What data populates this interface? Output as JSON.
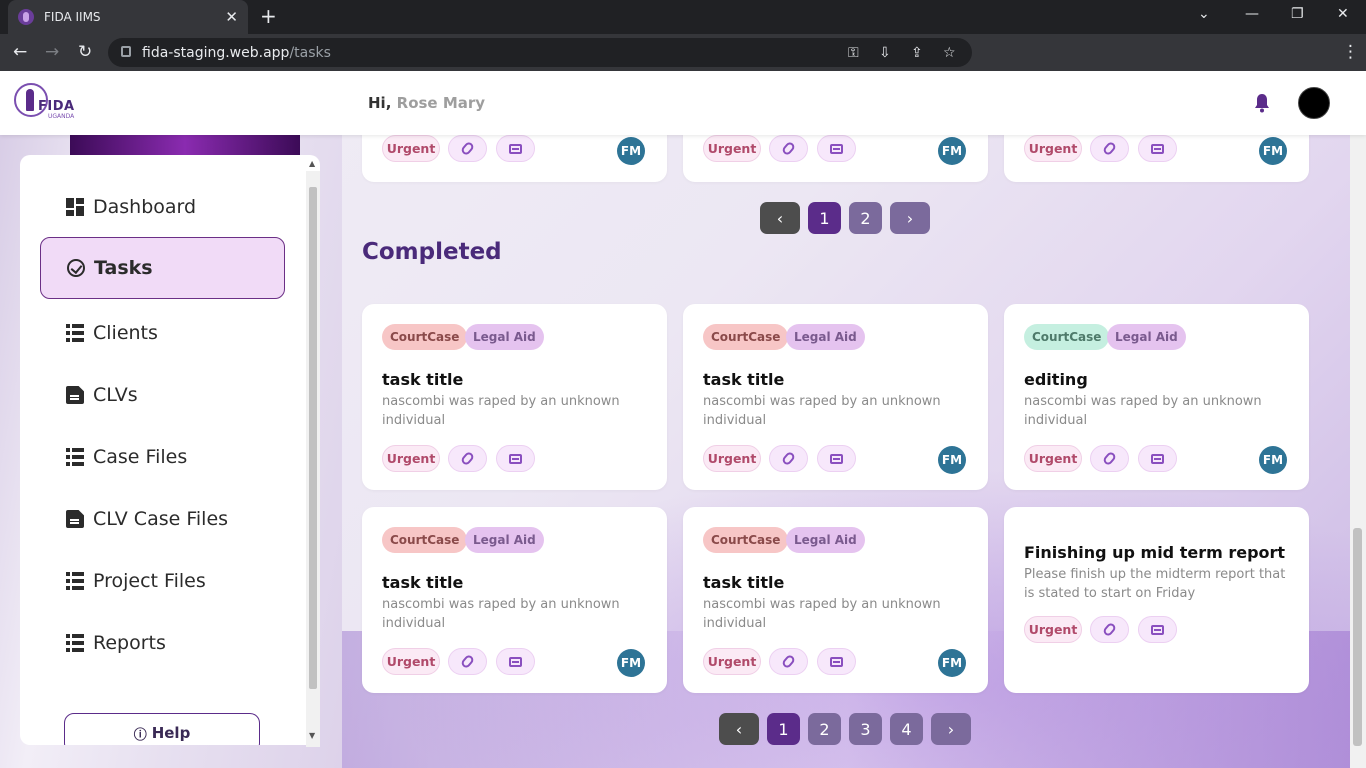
{
  "browser": {
    "tab_title": "FIDA IIMS",
    "url_domain": "fida-staging.web.app",
    "url_path": "/tasks"
  },
  "header": {
    "greeting": "Hi,",
    "user_name": "Rose Mary"
  },
  "logo": {
    "text": "FIDA",
    "sub": "UGANDA"
  },
  "sidebar": {
    "items": [
      {
        "label": "Dashboard",
        "icon": "dashboard-icon"
      },
      {
        "label": "Tasks",
        "icon": "check-circle-icon",
        "active": true
      },
      {
        "label": "Clients",
        "icon": "list-icon"
      },
      {
        "label": "CLVs",
        "icon": "document-icon"
      },
      {
        "label": "Case Files",
        "icon": "list-icon"
      },
      {
        "label": "CLV Case Files",
        "icon": "document-icon"
      },
      {
        "label": "Project Files",
        "icon": "list-icon"
      },
      {
        "label": "Reports",
        "icon": "list-icon"
      }
    ],
    "help_label": "Help"
  },
  "top_cards": [
    {
      "urgent": "Urgent",
      "assignee": "FM"
    },
    {
      "urgent": "Urgent",
      "assignee": "FM"
    },
    {
      "urgent": "Urgent",
      "assignee": "FM"
    }
  ],
  "top_pagination": {
    "pages": [
      "1",
      "2"
    ],
    "current": "1"
  },
  "completed": {
    "title": "Completed",
    "cards": [
      {
        "tags": [
          "CourtCase",
          "Legal Aid"
        ],
        "title": "task title",
        "description": "nascombi was raped by an unknown individual",
        "urgent": "Urgent",
        "assignee": ""
      },
      {
        "tags": [
          "CourtCase",
          "Legal Aid"
        ],
        "title": "task title",
        "description": "nascombi was raped by an unknown individual",
        "urgent": "Urgent",
        "assignee": "FM"
      },
      {
        "tags": [
          "CourtCase",
          "Legal Aid"
        ],
        "title": "editing",
        "description": "nascombi was raped by an unknown individual",
        "urgent": "Urgent",
        "assignee": "FM"
      },
      {
        "tags": [
          "CourtCase",
          "Legal Aid"
        ],
        "title": "task title",
        "description": "nascombi was raped by an unknown individual",
        "urgent": "Urgent",
        "assignee": "FM"
      },
      {
        "tags": [
          "CourtCase",
          "Legal Aid"
        ],
        "title": "task title",
        "description": "nascombi was raped by an unknown individual",
        "urgent": "Urgent",
        "assignee": "FM"
      },
      {
        "tags": [],
        "title": "Finishing up mid term report",
        "description": "Please finish up the midterm report that is stated to start on Friday",
        "urgent": "Urgent",
        "assignee": ""
      }
    ]
  },
  "bottom_pagination": {
    "pages": [
      "1",
      "2",
      "3",
      "4"
    ],
    "current": "1"
  },
  "colors": {
    "accent": "#5b2c8a",
    "active_bg": "#f1dbf7",
    "avatar": "#2e7496"
  }
}
